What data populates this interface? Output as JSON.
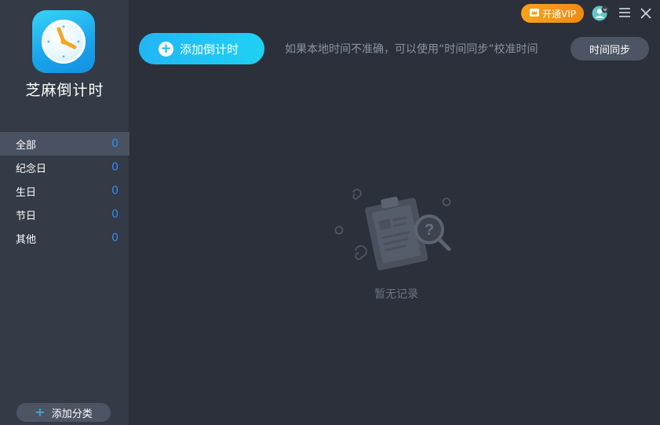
{
  "app": {
    "name": "芝麻倒计时"
  },
  "sidebar": {
    "categories": [
      {
        "label": "全部",
        "count": "0",
        "active": true
      },
      {
        "label": "纪念日",
        "count": "0"
      },
      {
        "label": "生日",
        "count": "0"
      },
      {
        "label": "节日",
        "count": "0"
      },
      {
        "label": "其他",
        "count": "0"
      }
    ],
    "add_category_label": "添加分类"
  },
  "toolbar": {
    "add_countdown_label": "添加倒计时",
    "hint": "如果本地时间不准确，可以使用“时间同步”校准时间",
    "sync_label": "时间同步"
  },
  "titlebar": {
    "vip_label": "开通VIP",
    "icons": [
      "crown-icon",
      "avatar-icon",
      "menu-icon",
      "close-icon"
    ]
  },
  "empty_state": {
    "text": "暂无记录",
    "icon": "empty-clipboard-search-icon"
  },
  "colors": {
    "accent": "#22b5f5",
    "count": "#2f8ef0",
    "vip": "#f7a21b",
    "sidebar_bg": "#343a46",
    "main_bg": "#2b303b"
  }
}
